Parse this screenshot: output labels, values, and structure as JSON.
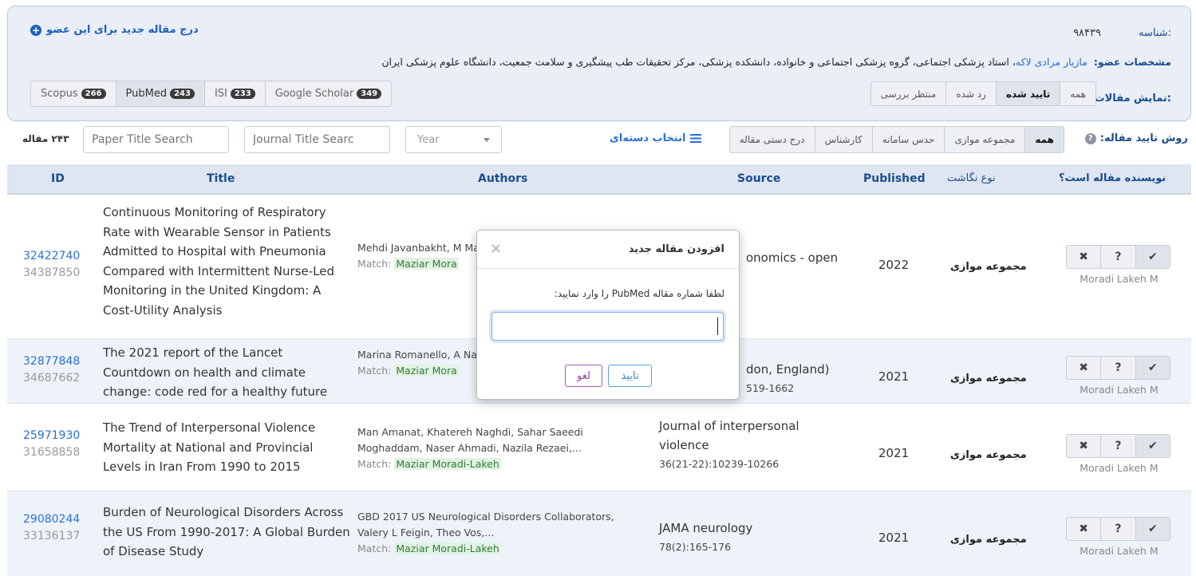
{
  "header": {
    "id_label": "شناسه:",
    "id_value": "۹۸۴۳۹",
    "add_article": "درج مقاله جدید برای این عضو",
    "member_label": "مشخصات عضو:",
    "member_name": "مازیار مرادی لاکه",
    "member_desc": "، استاد پزشکی اجتماعی، گروه پزشکی اجتماعی و خانواده، دانشکده پزشکی، مرکز تحقیقات طب پیشگیری و سلامت جمعیت، دانشگاه علوم پزشکی ایران",
    "show_label": "نمایش مقالات:",
    "show_options": [
      "همه",
      "تایید شده",
      "رد شده",
      "منتظر بررسی"
    ],
    "db_tabs": [
      {
        "label": "Scopus",
        "count": "266"
      },
      {
        "label": "PubMed",
        "count": "243"
      },
      {
        "label": "ISI",
        "count": "233"
      },
      {
        "label": "Google Scholar",
        "count": "349"
      }
    ]
  },
  "toolbar": {
    "method_label": "روش تایید مقاله:",
    "method_options": [
      "همه",
      "مجموعه موازی",
      "حدس سامانه",
      "کارشناس",
      "درج دستی مقاله"
    ],
    "batch_select": "انتخاب دسته‌ای",
    "year_placeholder": "Year",
    "journal_placeholder": "Journal Title Searc",
    "paper_placeholder": "Paper Title Search",
    "count": "۲۴۳ مقاله"
  },
  "table": {
    "headers": {
      "id": "ID",
      "title": "Title",
      "authors": "Authors",
      "source": "Source",
      "published": "Published",
      "type": "نوع نگاشت",
      "is_author": "نویسنده مقاله است؟"
    },
    "rows": [
      {
        "id1": "32422740",
        "id2": "34387850",
        "title": "Continuous Monitoring of Respiratory Rate with Wearable Sensor in Patients Admitted to Hospital with Pneumonia Compared with Intermittent Nurse-Led Monitoring in the United Kingdom: A Cost-Utility Analysis",
        "authors": "Mehdi Javanbakht, M Mashayekhi, Jowan A",
        "match_label": "Match:",
        "match_name": "Maziar Mora",
        "source": "onomics - open",
        "pages": "",
        "year": "2022",
        "type": "مجموعه موازی",
        "author_name": "Moradi Lakeh M"
      },
      {
        "id1": "32877848",
        "id2": "34687662",
        "title": "The 2021 report of the Lancet Countdown on health and climate change: code red for a healthy future",
        "authors": "Marina Romanello, A Napoli, Paul Drumm",
        "match_label": "Match:",
        "match_name": "Maziar Mora",
        "source": "don, England)",
        "pages": "519-1662",
        "year": "2021",
        "type": "مجموعه موازی",
        "author_name": "Moradi Lakeh M"
      },
      {
        "id1": "25971930",
        "id2": "31658858",
        "title": "The Trend of Interpersonal Violence Mortality at National and Provincial Levels in Iran From 1990 to 2015",
        "authors": "Man Amanat, Khatereh Naghdi, Sahar Saeedi Moghaddam, Naser Ahmadi, Nazila Rezaei,...",
        "match_label": "Match:",
        "match_name": "Maziar Moradi-Lakeh",
        "source": "Journal of interpersonal violence",
        "pages": "36(21-22):10239-10266",
        "year": "2021",
        "type": "مجموعه موازی",
        "author_name": "Moradi Lakeh M"
      },
      {
        "id1": "29080244",
        "id2": "33136137",
        "title": "Burden of Neurological Disorders Across the US From 1990-2017: A Global Burden of Disease Study",
        "authors": "GBD 2017 US Neurological Disorders Collaborators, Valery L Feigin, Theo Vos,...",
        "match_label": "Match:",
        "match_name": "Maziar Moradi-Lakeh",
        "source": "JAMA neurology",
        "pages": "78(2):165-176",
        "year": "2021",
        "type": "مجموعه موازی",
        "author_name": "Moradi Lakeh M"
      }
    ],
    "action_icons": [
      "close-icon",
      "question-icon",
      "check-icon"
    ]
  },
  "modal": {
    "title": "افزودن مقاله جدید",
    "close": "×",
    "prompt": "لطفا شماره مقاله PubMed را وارد نمایید:",
    "ok": "تایید",
    "cancel": "لغو"
  }
}
